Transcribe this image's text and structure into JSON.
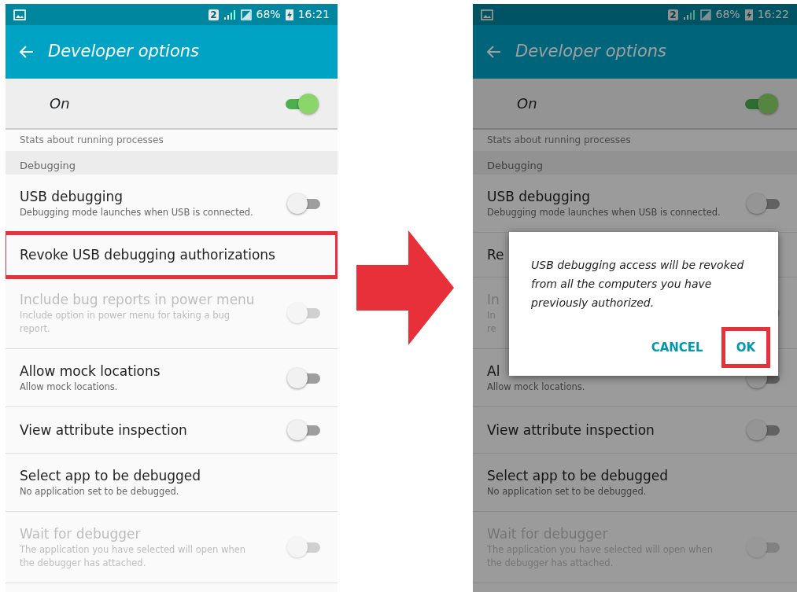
{
  "screens": [
    {
      "dimmed": false,
      "status_bar": {
        "sim": "2",
        "battery": "68%",
        "time": "16:21"
      },
      "title": "Developer options",
      "master_switch": {
        "label": "On",
        "on": true
      },
      "cut_text": "Stats about running processes",
      "section": "Debugging",
      "items": [
        {
          "title": "USB debugging",
          "subtitle": "Debugging mode launches when USB is connected.",
          "kind": "toggle",
          "on": false,
          "disabled": false
        },
        {
          "title": "Revoke USB debugging authorizations",
          "kind": "plain",
          "disabled": false,
          "highlighted": true
        },
        {
          "title": "Include bug reports in power menu",
          "subtitle": "Include option in power menu for taking a bug report.",
          "kind": "toggle",
          "on": false,
          "disabled": true
        },
        {
          "title": "Allow mock locations",
          "subtitle": "Allow mock locations.",
          "kind": "toggle",
          "on": false,
          "disabled": false
        },
        {
          "title": "View attribute inspection",
          "kind": "toggle",
          "on": false,
          "disabled": false
        },
        {
          "title": "Select app to be debugged",
          "subtitle": "No application set to be debugged.",
          "kind": "plain",
          "disabled": false
        },
        {
          "title": "Wait for debugger",
          "subtitle": "The application you have selected will open when the debugger has attached.",
          "kind": "toggle",
          "on": false,
          "disabled": true
        }
      ]
    },
    {
      "dimmed": true,
      "status_bar": {
        "sim": "2",
        "battery": "68%",
        "time": "16:22"
      },
      "title": "Developer options",
      "master_switch": {
        "label": "On",
        "on": true
      },
      "cut_text": "Stats about running processes",
      "section": "Debugging",
      "items": [
        {
          "title": "USB debugging",
          "subtitle": "Debugging mode launches when USB is connected.",
          "kind": "toggle",
          "on": false,
          "disabled": false
        },
        {
          "title": "Re",
          "kind": "plain",
          "disabled": false
        },
        {
          "title": "In",
          "subtitle": "In\nre",
          "kind": "toggle",
          "on": false,
          "disabled": true
        },
        {
          "title": "Al",
          "subtitle": "Allow mock locations.",
          "kind": "toggle",
          "on": false,
          "disabled": false
        },
        {
          "title": "View attribute inspection",
          "kind": "toggle",
          "on": false,
          "disabled": false
        },
        {
          "title": "Select app to be debugged",
          "subtitle": "No application set to be debugged.",
          "kind": "plain",
          "disabled": false
        },
        {
          "title": "Wait for debugger",
          "subtitle": "The application you have selected will open when the debugger has attached.",
          "kind": "toggle",
          "on": false,
          "disabled": true
        }
      ],
      "dialog": {
        "message": "USB debugging access will be revoked from all the computers you have previously authorized.",
        "buttons": [
          {
            "label": "CANCEL"
          },
          {
            "label": "OK",
            "highlighted": true
          }
        ]
      }
    }
  ]
}
